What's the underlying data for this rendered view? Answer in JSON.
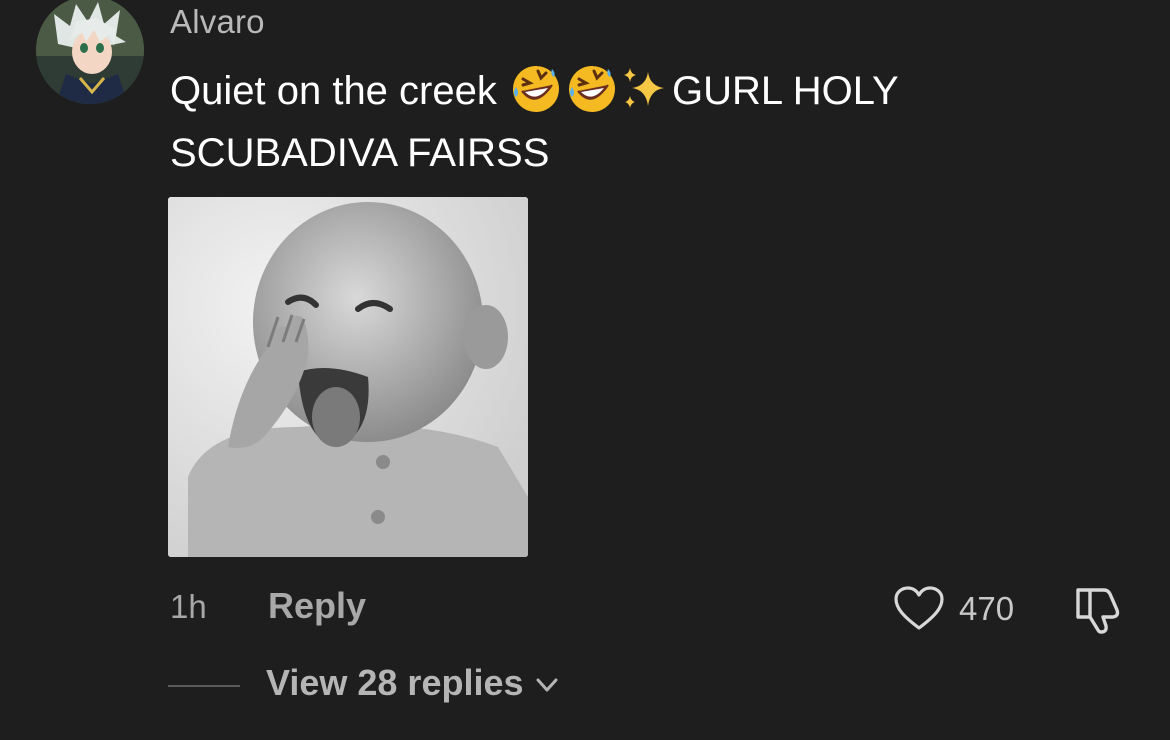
{
  "comment": {
    "username": "Alvaro",
    "text_part1": "Quiet on the creek ",
    "text_part2": "GURL HOLY SCUBADIVA FAIRSS",
    "emojis": [
      "rolling-on-floor-laughing-emoji",
      "rolling-on-floor-laughing-emoji",
      "sparkles-emoji"
    ],
    "timestamp": "1h",
    "reply_label": "Reply",
    "like_count": "470",
    "view_replies_label": "View 28 replies"
  },
  "icons": {
    "avatar": "anime-character-avatar",
    "like": "heart-icon",
    "dislike": "thumbs-down-icon",
    "expand": "chevron-down-icon"
  },
  "colors": {
    "background": "#1e1e1e",
    "primary_text": "#ffffff",
    "secondary_text": "#a8a8a8",
    "emoji_yellow": "#f5b921"
  }
}
